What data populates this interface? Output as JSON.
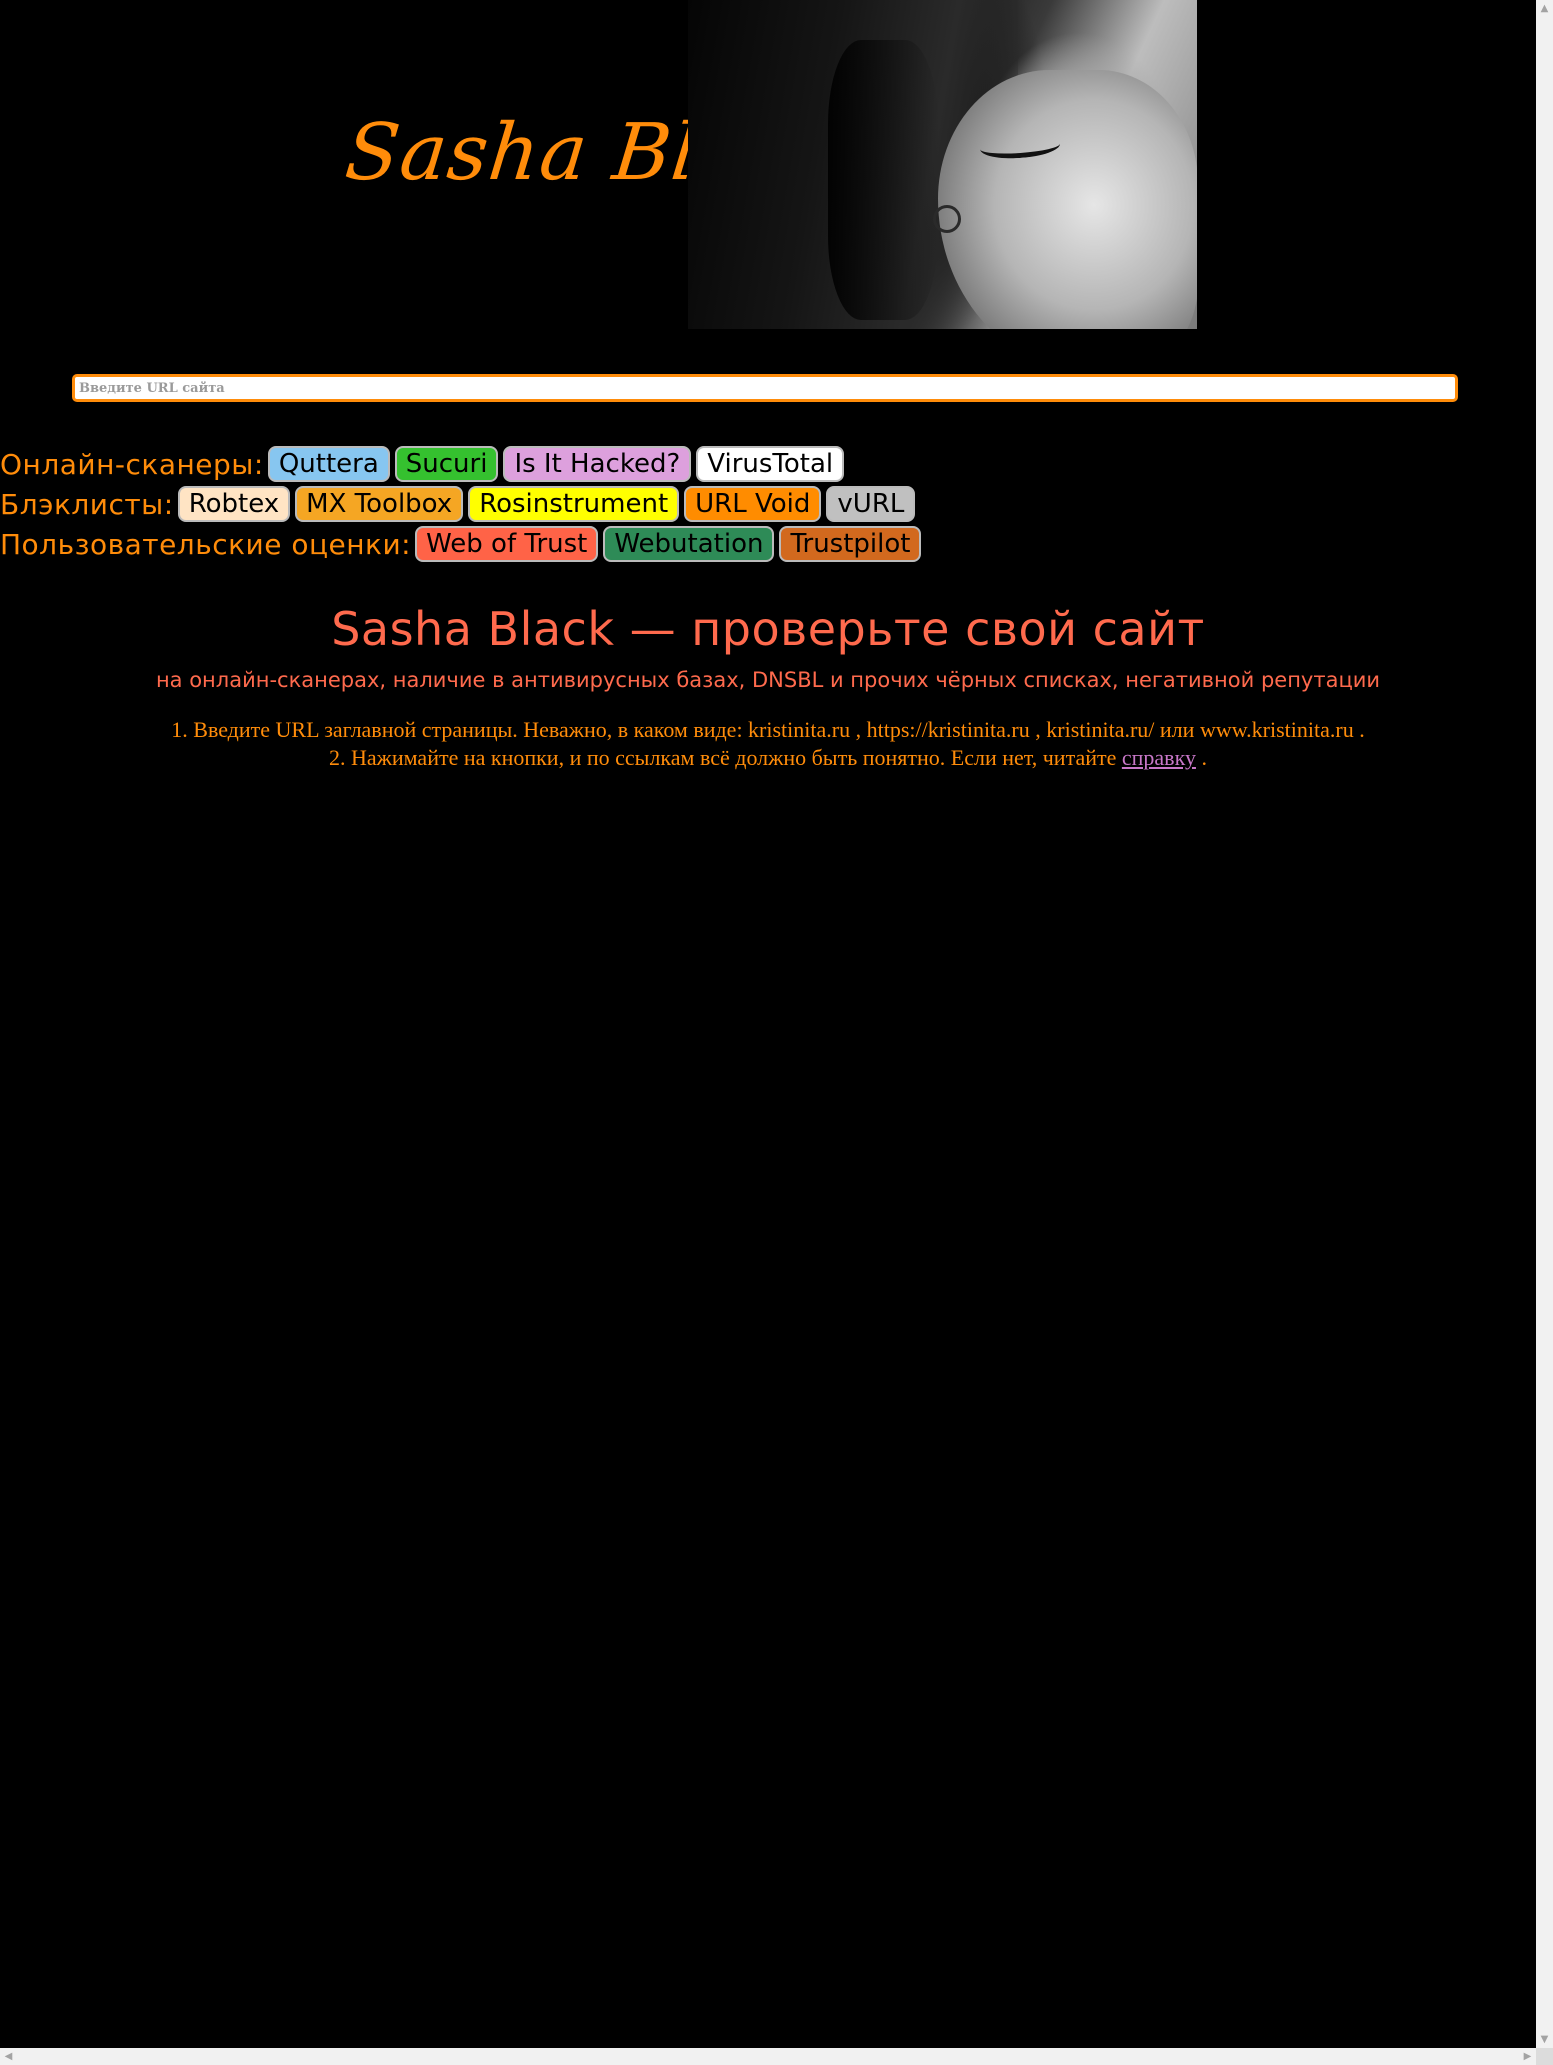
{
  "header": {
    "logo_text": "Sasha Black"
  },
  "search": {
    "placeholder": "Введите URL сайта",
    "value": ""
  },
  "rows": [
    {
      "label": "Онлайн-сканеры:",
      "buttons": [
        {
          "label": "Quttera",
          "color": "#87c6f0"
        },
        {
          "label": "Sucuri",
          "color": "#35c12f"
        },
        {
          "label": "Is It Hacked?",
          "color": "#dda0dd"
        },
        {
          "label": "VirusTotal",
          "color": "#ffffff"
        }
      ]
    },
    {
      "label": "Блэклисты:",
      "buttons": [
        {
          "label": "Robtex",
          "color": "#ffe4c4"
        },
        {
          "label": "MX Toolbox",
          "color": "#f5a623"
        },
        {
          "label": "Rosinstrument",
          "color": "#ffff00"
        },
        {
          "label": "URL Void",
          "color": "#ff8c00"
        },
        {
          "label": "vURL",
          "color": "#c0c0c0"
        }
      ]
    },
    {
      "label": "Пользовательские оценки:",
      "buttons": [
        {
          "label": "Web of Trust",
          "color": "#ff6347"
        },
        {
          "label": "Webutation",
          "color": "#2e8b57"
        },
        {
          "label": "Trustpilot",
          "color": "#d2691e"
        }
      ]
    }
  ],
  "main": {
    "title": "Sasha Black — проверьте свой сайт",
    "subtitle": "на онлайн-сканерах, наличие в антивирусных базах, DNSBL и прочих чёрных списках, негативной репутации",
    "line1": "1. Введите URL заглавной страницы. Неважно, в каком виде: kristinita.ru , https://kristinita.ru , kristinita.ru/ или www.kristinita.ru .",
    "line2_before": "2. Нажимайте на кнопки, и по ссылкам всё должно быть понятно. Если нет, читайте ",
    "line2_link": "справку",
    "line2_after": " ."
  },
  "colors": {
    "accent_orange": "#ff8c0a",
    "title_red": "#ff6a4d",
    "link_purple": "#c877c8",
    "background": "#000000"
  },
  "icons": {
    "scroll_up": "▲",
    "scroll_down": "▼",
    "scroll_left": "◀",
    "scroll_right": "▶"
  }
}
